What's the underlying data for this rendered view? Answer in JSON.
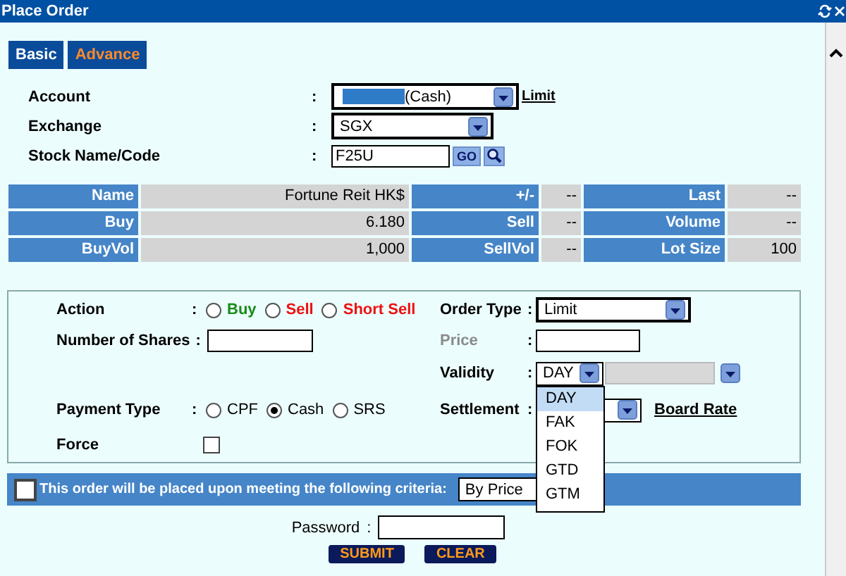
{
  "window": {
    "title": "Place Order"
  },
  "tabs": [
    {
      "label": "Basic",
      "selected": false
    },
    {
      "label": "Advance",
      "selected": true
    }
  ],
  "header_fields": [
    {
      "kind": "select",
      "label": "Account",
      "separator": ":",
      "value": "(Cash)",
      "redacted": true,
      "link": "Limit"
    },
    {
      "kind": "select",
      "label": "Exchange",
      "separator": ":",
      "value": "SGX"
    },
    {
      "kind": "code",
      "label": "Stock Name/Code",
      "separator": ":",
      "value": "F25U",
      "button": "GO"
    }
  ],
  "quote_rows": [
    [
      {
        "label": "Name",
        "value": "Fortune Reit HK$"
      },
      {
        "label": "+/-",
        "value": "--"
      },
      {
        "label": "Last",
        "value": "--"
      }
    ],
    [
      {
        "label": "Buy",
        "value": "6.180"
      },
      {
        "label": "Sell",
        "value": "--"
      },
      {
        "label": "Volume",
        "value": "--"
      }
    ],
    [
      {
        "label": "BuyVol",
        "value": "1,000"
      },
      {
        "label": "SellVol",
        "value": "--"
      },
      {
        "label": "Lot Size",
        "value": "100"
      }
    ]
  ],
  "action": {
    "label": "Action",
    "separator": ":",
    "options": [
      {
        "label": "Buy",
        "selected": false,
        "color": "#1a8a1a"
      },
      {
        "label": "Sell",
        "selected": false,
        "color": "#ee1111"
      },
      {
        "label": "Short Sell",
        "selected": false,
        "color": "#ee1111"
      }
    ]
  },
  "shares": {
    "label": "Number of Shares",
    "separator": ":"
  },
  "order_type": {
    "label": "Order Type",
    "separator": ":",
    "value": "Limit"
  },
  "price": {
    "label": "Price",
    "separator": ":",
    "disabled": true
  },
  "validity": {
    "label": "Validity",
    "separator": ":",
    "value": "DAY",
    "expanded": true,
    "options": [
      {
        "label": "DAY",
        "selected": true
      },
      {
        "label": "FAK",
        "selected": false
      },
      {
        "label": "FOK",
        "selected": false
      },
      {
        "label": "GTD",
        "selected": false
      },
      {
        "label": "GTM",
        "selected": false
      }
    ]
  },
  "payment": {
    "label": "Payment Type",
    "separator": ":",
    "options": [
      {
        "label": "CPF",
        "selected": false
      },
      {
        "label": "Cash",
        "selected": true
      },
      {
        "label": "SRS",
        "selected": false
      }
    ]
  },
  "settlement": {
    "label": "Settlement",
    "separator": ":",
    "link": "Board Rate"
  },
  "force": {
    "label": "Force",
    "checked": false
  },
  "criteria": {
    "checked": false,
    "text": "This order will be placed upon meeting the following criteria:",
    "value": "By Price"
  },
  "password": {
    "label": "Password",
    "separator": ":"
  },
  "buttons": [
    "SUBMIT",
    "CLEAR"
  ]
}
